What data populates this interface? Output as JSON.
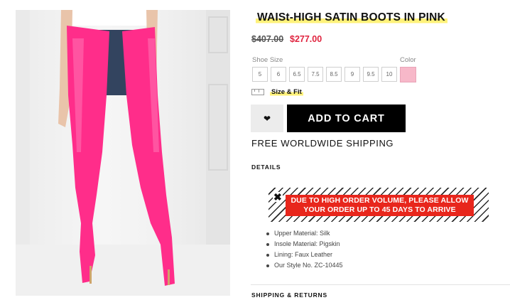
{
  "product": {
    "title": "WAISt-HIGH SATIN BOOTS IN PINK",
    "old_price": "$407.00",
    "price": "$277.00",
    "image_alt": "model wearing pink satin thigh-high boots"
  },
  "options": {
    "size_label": "Shoe Size",
    "color_label": "Color",
    "sizes": [
      "5",
      "6",
      "6.5",
      "7.5",
      "8.5",
      "9",
      "9.5",
      "10"
    ],
    "color_swatch": "#f7b8c9",
    "size_fit_label": "Size & Fit"
  },
  "actions": {
    "wishlist_icon": "heart-icon",
    "add_to_cart": "ADD TO CART"
  },
  "shipping_note": "FREE WORLDWIDE SHIPPING",
  "details": {
    "heading": "DETAILS",
    "notice_line1": "DUE TO HIGH ORDER VOLUME, PLEASE ALLOW",
    "notice_line2": "YOUR ORDER UP TO 45 DAYS TO ARRIVE",
    "specs": [
      "Upper Material: Silk",
      "Insole Material: Pigskin",
      "Lining: Faux Leather",
      "Our Style No. ZC-10445"
    ]
  },
  "shipping_returns": "SHIPPING & RETURNS",
  "colors": {
    "accent_pink": "#ff2d8a",
    "sale_red": "#e0243f",
    "notice_red": "#e8261c",
    "highlight_yellow": "#fff27a"
  }
}
